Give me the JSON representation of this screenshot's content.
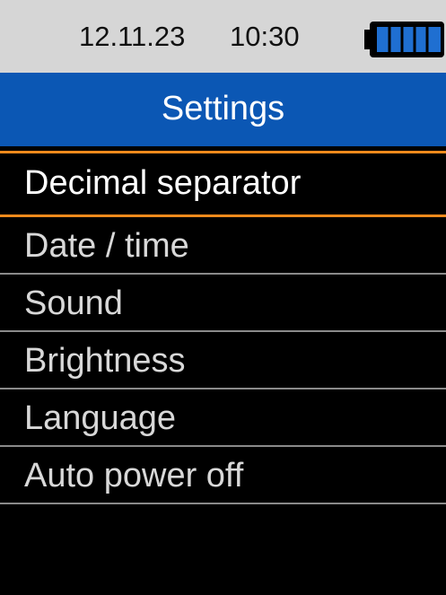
{
  "status": {
    "date": "12.11.23",
    "time": "10:30",
    "battery_icon": "battery-icon",
    "battery_level": 1.0
  },
  "header": {
    "title": "Settings"
  },
  "menu": {
    "items": [
      {
        "label": "Decimal separator",
        "selected": true
      },
      {
        "label": "Date / time",
        "selected": false
      },
      {
        "label": "Sound",
        "selected": false
      },
      {
        "label": "Brightness",
        "selected": false
      },
      {
        "label": "Language",
        "selected": false
      },
      {
        "label": "Auto power off",
        "selected": false
      }
    ]
  },
  "colors": {
    "title_bar": "#0b57b4",
    "selection_border": "#f08a1c",
    "status_bar": "#d6d6d6",
    "background": "#000000"
  }
}
